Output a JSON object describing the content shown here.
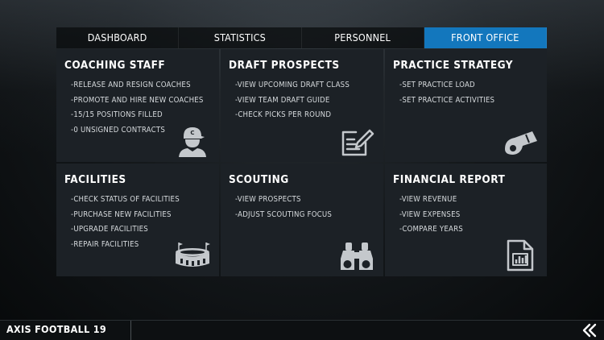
{
  "tabs": [
    {
      "label": "DASHBOARD",
      "active": false
    },
    {
      "label": "STATISTICS",
      "active": false
    },
    {
      "label": "PERSONNEL",
      "active": false
    },
    {
      "label": "FRONT OFFICE",
      "active": true
    }
  ],
  "cards": [
    {
      "title": "COACHING STAFF",
      "icon": "coach-icon",
      "items": [
        "-RELEASE AND RESIGN COACHES",
        "-PROMOTE AND HIRE NEW COACHES",
        "-15/15 POSITIONS FILLED",
        "-0 UNSIGNED CONTRACTS"
      ]
    },
    {
      "title": "DRAFT PROSPECTS",
      "icon": "notepad-pencil-icon",
      "items": [
        "-VIEW UPCOMING DRAFT CLASS",
        "-VIEW TEAM DRAFT GUIDE",
        "-CHECK PICKS PER ROUND"
      ]
    },
    {
      "title": "PRACTICE STRATEGY",
      "icon": "whistle-icon",
      "items": [
        "-SET PRACTICE LOAD",
        "-SET PRACTICE ACTIVITIES"
      ]
    },
    {
      "title": "FACILITIES",
      "icon": "stadium-icon",
      "items": [
        "-CHECK STATUS OF FACILITIES",
        "-PURCHASE NEW FACILITIES",
        "-UPGRADE FACILITIES",
        "-REPAIR FACILITIES"
      ]
    },
    {
      "title": "SCOUTING",
      "icon": "binoculars-icon",
      "items": [
        "-VIEW PROSPECTS",
        "-ADJUST SCOUTING FOCUS"
      ]
    },
    {
      "title": "FINANCIAL REPORT",
      "icon": "report-chart-icon",
      "items": [
        "-VIEW REVENUE",
        "-VIEW EXPENSES",
        "-COMPARE YEARS"
      ]
    }
  ],
  "footer": {
    "brand": "AXIS FOOTBALL 19",
    "back_icon": "double-chevron-left-icon"
  },
  "colors": {
    "active_tab": "#1377bd",
    "card_bg": "#1c2126",
    "icon": "#c4c8cc"
  }
}
